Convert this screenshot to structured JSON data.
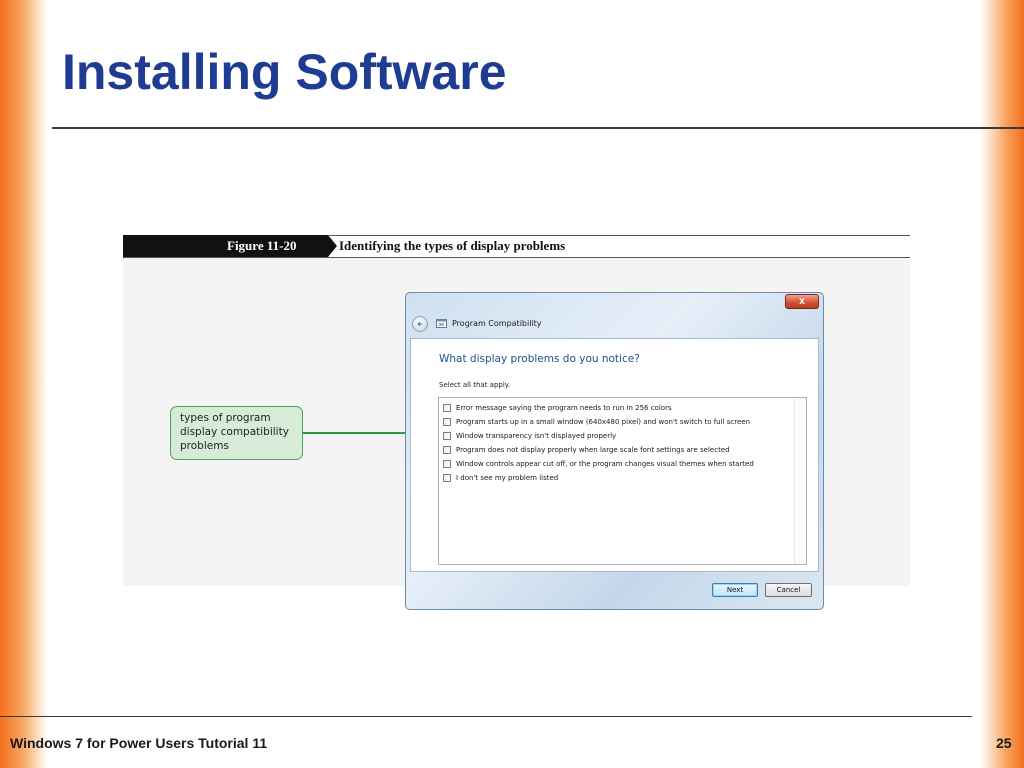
{
  "slide": {
    "title": "Installing Software",
    "footer": "Windows 7 for Power Users Tutorial 11",
    "page_number": "25",
    "accent_color": "#f26f1d",
    "title_color": "#1f3c93"
  },
  "figure": {
    "label": "Figure 11-20",
    "caption": "Identifying the types of display problems",
    "callout": "types of program display compatibility problems"
  },
  "dialog": {
    "window_title": "Program Compatibility",
    "close_label": "x",
    "heading": "What display problems do you notice?",
    "instruction": "Select all that apply.",
    "options": [
      {
        "label": "Error message saying the program needs to run in 256 colors",
        "checked": false
      },
      {
        "label": "Program starts up in a small window (640x480 pixel) and won't switch to full screen",
        "checked": false
      },
      {
        "label": "Window transparency isn't displayed properly",
        "checked": false
      },
      {
        "label": "Program does not display properly when large scale font settings are selected",
        "checked": false
      },
      {
        "label": "Window controls appear cut off, or the program changes visual themes when started",
        "checked": false
      },
      {
        "label": "I don't see my problem listed",
        "checked": false
      }
    ],
    "buttons": {
      "next": "Next",
      "cancel": "Cancel"
    }
  }
}
